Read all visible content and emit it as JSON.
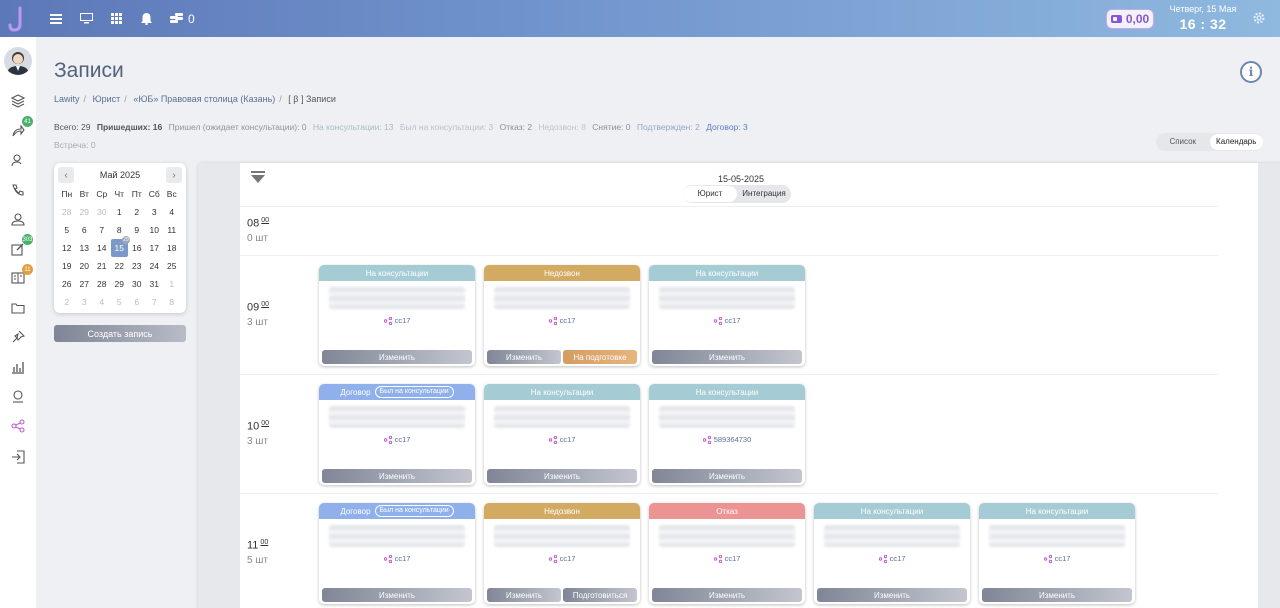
{
  "topbar": {
    "coins_count": "0",
    "balance": "0,00",
    "date": "Четверг, 15 Мая",
    "time": "16 : 32"
  },
  "sidebar": {
    "badges": {
      "contracts": "41",
      "edits": "303",
      "journal": "11"
    }
  },
  "page": {
    "title": "Записи",
    "breadcrumbs": [
      "Lawity",
      "Юрист",
      "«ЮБ» Правовая столица (Казань)",
      "[ β ] Записи"
    ]
  },
  "stats": {
    "total": "Всего: 29",
    "arrived": "Пришедших: 16",
    "waiting": "Пришел (ожидает консультации): 0",
    "in_consult": "На консультации: 13",
    "was_consult": "Был на консультации: 3",
    "refusal": "Отказ: 2",
    "no_answer": "Недозвон: 8",
    "removed": "Снятие: 0",
    "confirmed": "Подтвержден: 2",
    "contract": "Договор: 3",
    "meeting": "Встреча: 0"
  },
  "view_toggle": {
    "list": "Список",
    "calendar": "Календарь"
  },
  "calendar": {
    "month": "Май 2025",
    "weekdays": [
      "Пн",
      "Вт",
      "Ср",
      "Чт",
      "Пт",
      "Сб",
      "Вс"
    ],
    "days": [
      "28",
      "29",
      "30",
      "1",
      "2",
      "3",
      "4",
      "5",
      "6",
      "7",
      "8",
      "9",
      "10",
      "11",
      "12",
      "13",
      "14",
      "15",
      "16",
      "17",
      "18",
      "19",
      "20",
      "21",
      "22",
      "23",
      "24",
      "25",
      "26",
      "27",
      "28",
      "29",
      "30",
      "31",
      "1",
      "2",
      "3",
      "4",
      "5",
      "6",
      "7",
      "8"
    ],
    "selected_badge": "29"
  },
  "create_button": "Создать запись",
  "board": {
    "date": "15-05-2025",
    "filter": {
      "lawyer": "Юрист",
      "integration": "Интеграция"
    },
    "rows": [
      {
        "hour": "08",
        "minutes": "00",
        "count": "0 шт"
      },
      {
        "hour": "09",
        "minutes": "00",
        "count": "3 шт"
      },
      {
        "hour": "10",
        "minutes": "00",
        "count": "3 шт"
      },
      {
        "hour": "11",
        "minutes": "00",
        "count": "5 шт"
      }
    ],
    "cards": {
      "r9c1": {
        "status": "На консультации",
        "tag": "cc17",
        "btn1": "Изменить"
      },
      "r9c2": {
        "status": "Недозвон",
        "tag": "cc17",
        "btn1": "Изменить",
        "btn2": "На подготовке"
      },
      "r9c3": {
        "status": "На консультации",
        "tag": "cc17",
        "btn1": "Изменить"
      },
      "r10c1": {
        "status": "Договор",
        "pill": "Был на консультации",
        "tag": "cc17",
        "btn1": "Изменить"
      },
      "r10c2": {
        "status": "На консультации",
        "tag": "cc17",
        "btn1": "Изменить"
      },
      "r10c3": {
        "status": "На консультации",
        "tag": "589364730",
        "btn1": "Изменить"
      },
      "r11c1": {
        "status": "Договор",
        "pill": "Был на консультации",
        "tag": "cc17",
        "btn1": "Изменить"
      },
      "r11c2": {
        "status": "Недозвон",
        "tag": "cc17",
        "btn1": "Изменить",
        "btn2": "Подготовиться"
      },
      "r11c3": {
        "status": "Отказ",
        "tag": "cc17",
        "btn1": "Изменить"
      },
      "r11c4": {
        "status": "На консультации",
        "tag": "cc17",
        "btn1": "Изменить"
      },
      "r11c5": {
        "status": "На консультации",
        "tag": "cc17",
        "btn1": "Изменить"
      }
    }
  },
  "colors": {
    "consult": "#a5cbd4",
    "no_answer": "#d3aa62",
    "contract": "#8fb0ea",
    "refusal": "#ec9393"
  }
}
